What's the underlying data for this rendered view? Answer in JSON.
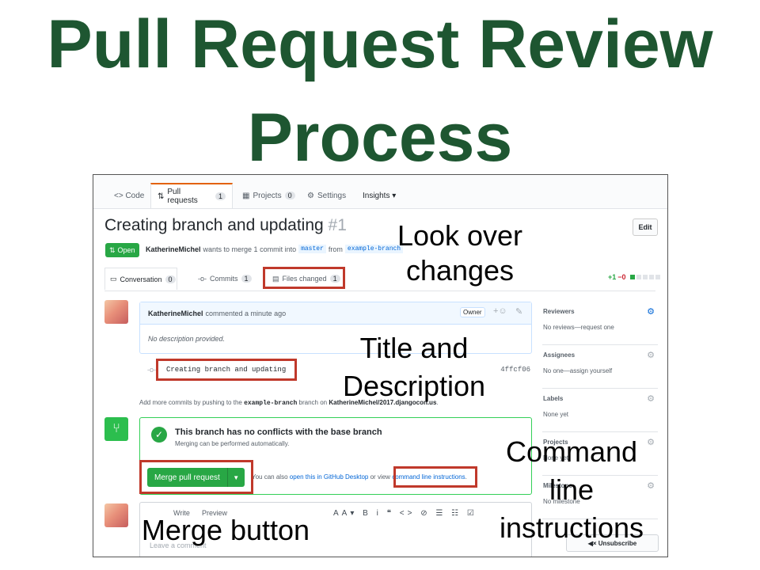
{
  "slide": {
    "title_line1": "Pull Request Review",
    "title_line2": "Process"
  },
  "repo_tabs": [
    {
      "label": "<> Code"
    },
    {
      "label": "Pull requests",
      "count": "1"
    },
    {
      "label": "Projects",
      "count": "0"
    },
    {
      "label": "Settings"
    },
    {
      "label": "Insights ▾"
    }
  ],
  "pr": {
    "title": "Creating branch and updating",
    "number": "#1",
    "edit_label": "Edit",
    "state": "Open",
    "author": "KatherineMichel",
    "merge_text": "wants to merge 1 commit into",
    "base_branch": "master",
    "from_text": "from",
    "head_branch": "example-branch"
  },
  "sub_tabs": [
    {
      "label": "Conversation",
      "count": "0"
    },
    {
      "label": "Commits",
      "count": "1"
    },
    {
      "label": "Files changed",
      "count": "1"
    }
  ],
  "diffstat": {
    "added": "+1",
    "removed": "−0"
  },
  "comment": {
    "author": "KatherineMichel",
    "meta": "commented a minute ago",
    "role": "Owner",
    "body": "No description provided."
  },
  "commit": {
    "message": "Creating branch and updating",
    "sha": "4ffcf06"
  },
  "hint": {
    "prefix": "Add more commits by pushing to the",
    "branch": "example-branch",
    "middle": "branch on",
    "repo": "KatherineMichel/2017.djangocon.us",
    "suffix": "."
  },
  "merge": {
    "title": "This branch has no conflicts with the base branch",
    "subtitle": "Merging can be performed automatically.",
    "button": "Merge pull request",
    "also_prefix": "You can also",
    "desktop_link": "open this in GitHub Desktop",
    "also_mid": "or view",
    "cli_link": "command line instructions",
    "also_suffix": "."
  },
  "editor": {
    "write": "Write",
    "preview": "Preview",
    "tools": "AA▾ B i  ❝ <> ⊘  ☰ ☷ ☑",
    "placeholder": "Leave a comment"
  },
  "sidebar": [
    {
      "heading": "Reviewers",
      "value": "No reviews—request one"
    },
    {
      "heading": "Assignees",
      "value": "No one—assign yourself"
    },
    {
      "heading": "Labels",
      "value": "None yet"
    },
    {
      "heading": "Projects",
      "value": "None yet"
    },
    {
      "heading": "Milestone",
      "value": "No milestone"
    }
  ],
  "unsubscribe": "◀× Unsubscribe",
  "annotations": {
    "look_over_1": "Look over",
    "look_over_2": "changes",
    "title_desc_1": "Title and",
    "title_desc_2": "Description",
    "cmd_1": "Command",
    "cmd_2": "line",
    "cmd_3": "instructions",
    "merge_button": "Merge button"
  },
  "colors": {
    "title_green": "#1e5631",
    "highlight": "#c0392b",
    "github_green": "#28a745"
  }
}
